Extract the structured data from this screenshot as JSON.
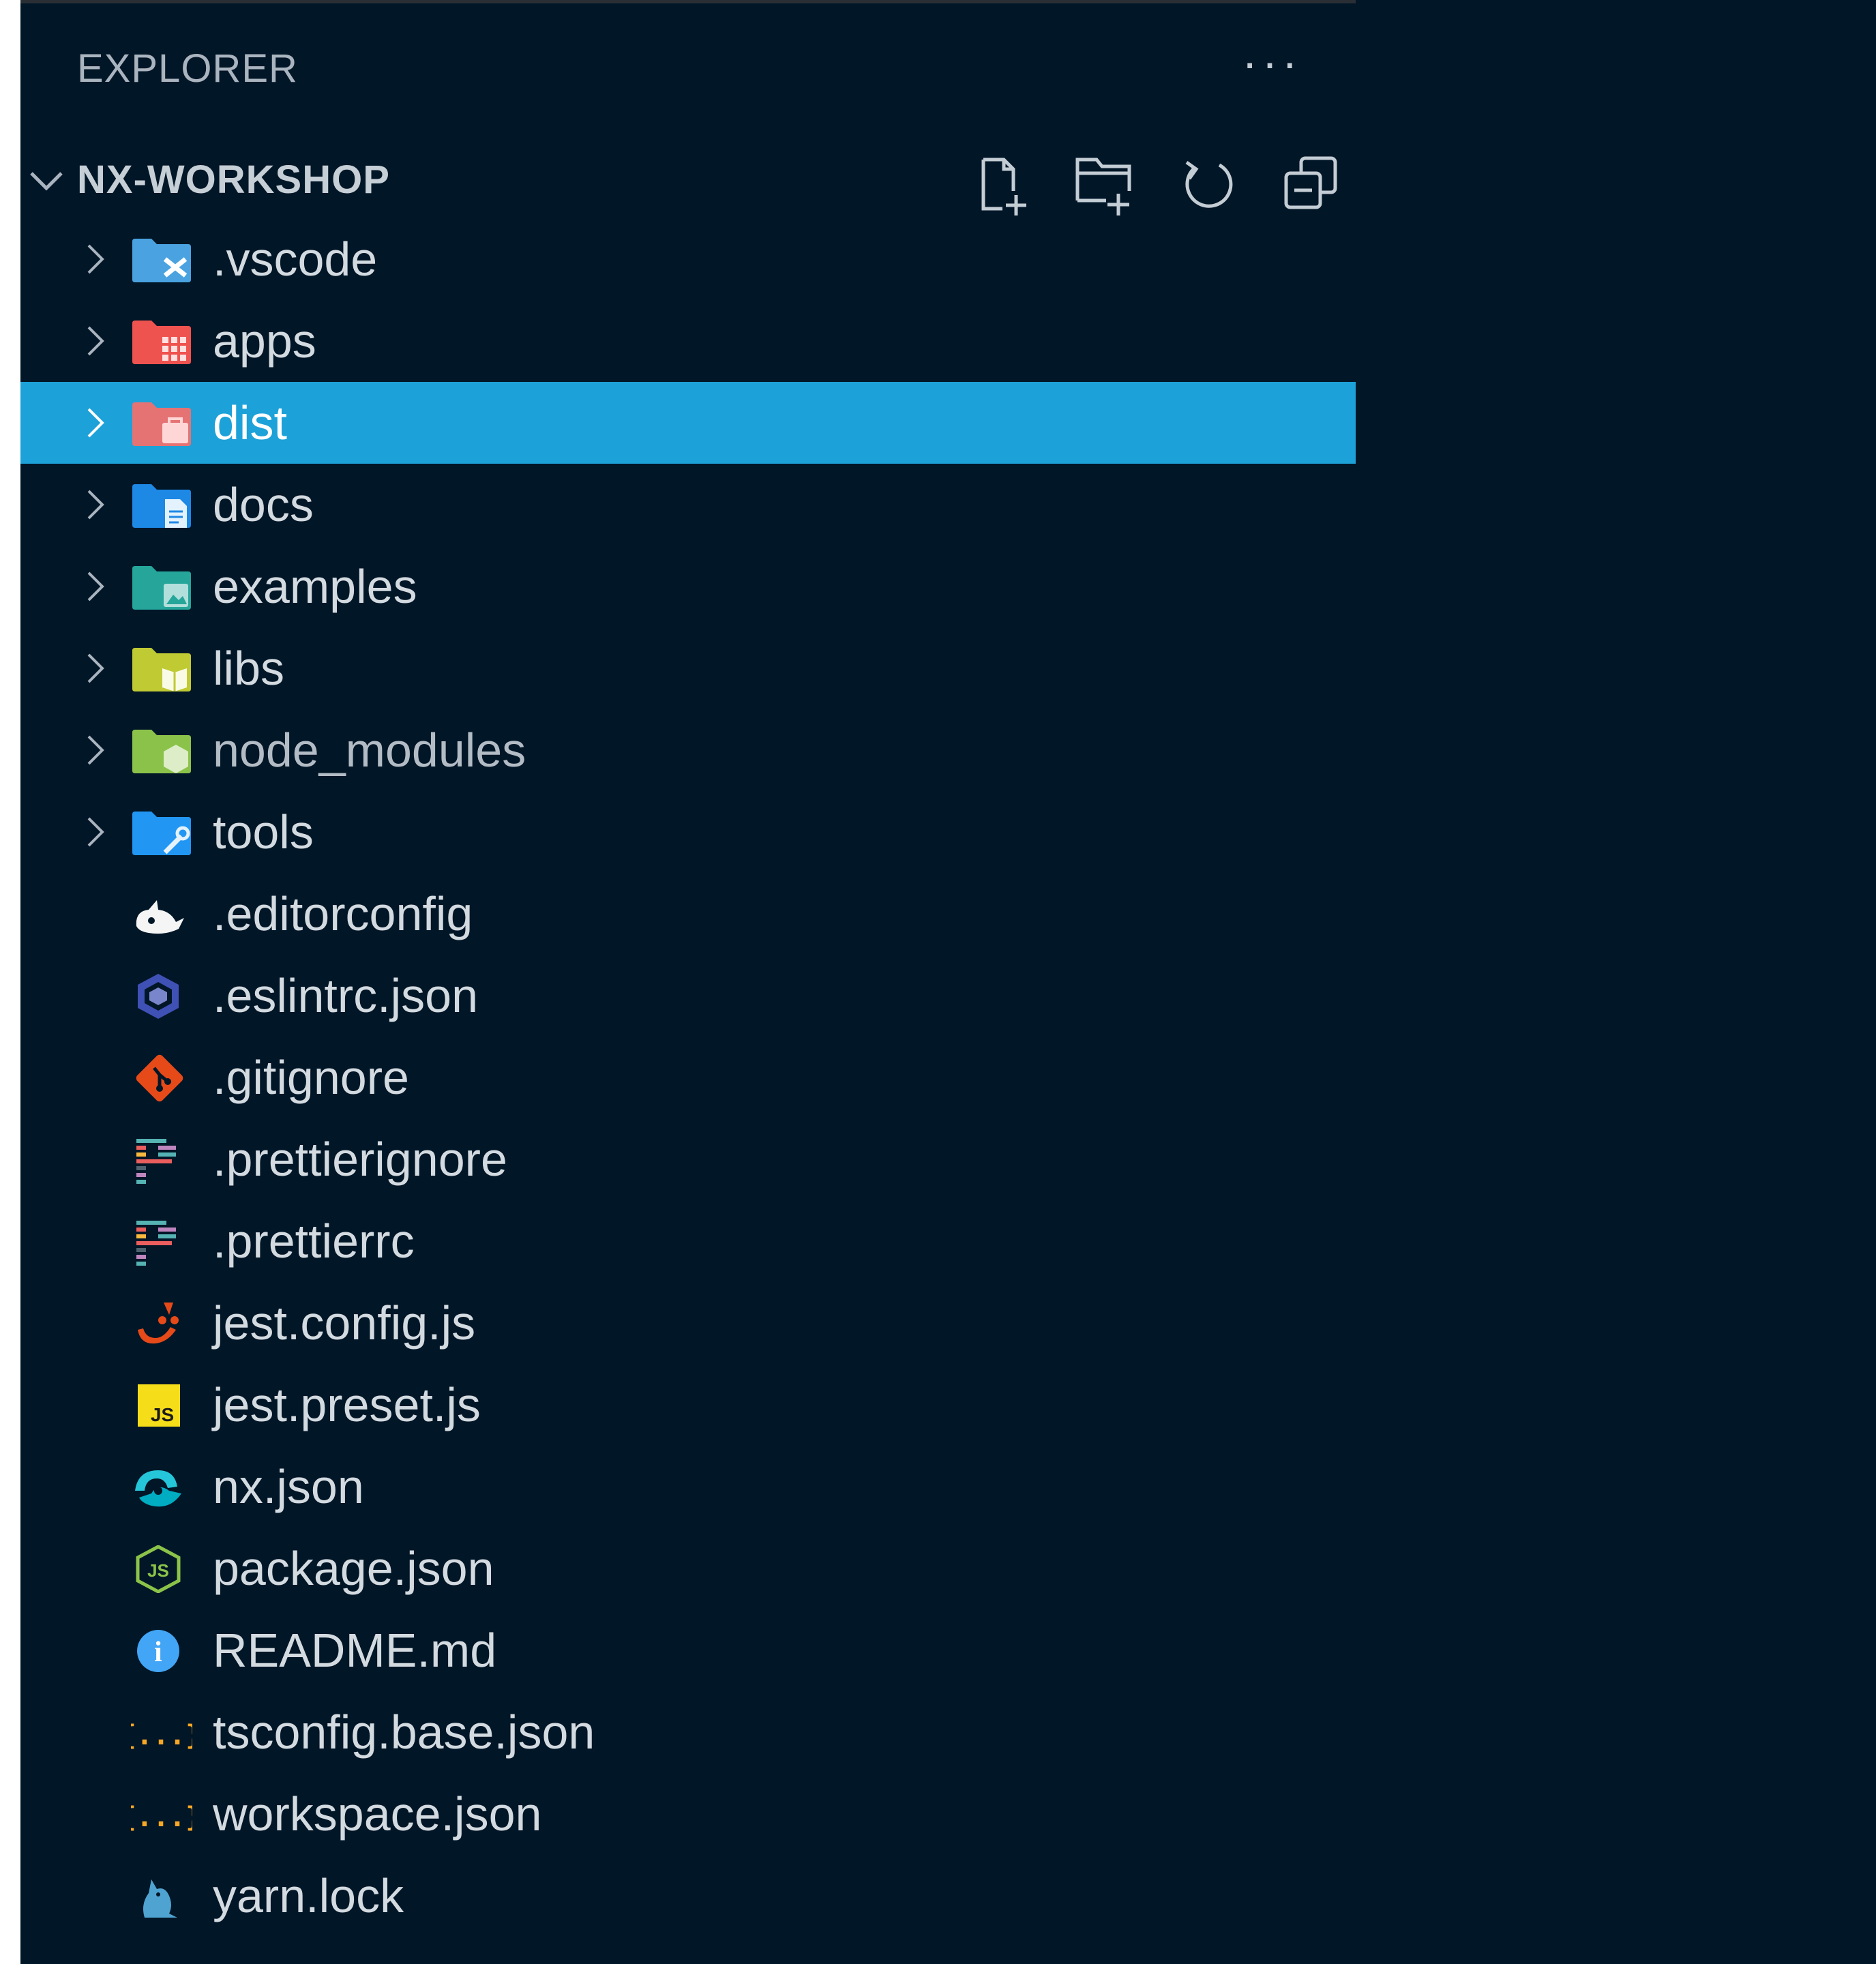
{
  "explorer": {
    "title": "EXPLORER",
    "more_label": "···"
  },
  "workspace": {
    "name": "NX-WORKSHOP",
    "expanded": true,
    "actions": [
      {
        "id": "new-file",
        "icon": "new-file-icon"
      },
      {
        "id": "new-folder",
        "icon": "new-folder-icon"
      },
      {
        "id": "refresh",
        "icon": "refresh-icon"
      },
      {
        "id": "collapse-all",
        "icon": "collapse-all-icon"
      }
    ]
  },
  "tree": {
    "folders": [
      {
        "label": ".vscode",
        "icon": "vscode-folder-icon",
        "color": "#4aa3e0"
      },
      {
        "label": "apps",
        "icon": "apps-folder-icon",
        "color": "#ef5350"
      },
      {
        "label": "dist",
        "icon": "dist-folder-icon",
        "color": "#e57373",
        "selected": true
      },
      {
        "label": "docs",
        "icon": "docs-folder-icon",
        "color": "#1e88e5"
      },
      {
        "label": "examples",
        "icon": "examples-folder-icon",
        "color": "#26a69a"
      },
      {
        "label": "libs",
        "icon": "libs-folder-icon",
        "color": "#c0ca33"
      },
      {
        "label": "node_modules",
        "icon": "node-modules-folder-icon",
        "color": "#8bc34a"
      },
      {
        "label": "tools",
        "icon": "tools-folder-icon",
        "color": "#2196f3"
      }
    ],
    "files": [
      {
        "label": ".editorconfig",
        "icon": "editorconfig-icon"
      },
      {
        "label": ".eslintrc.json",
        "icon": "eslint-icon"
      },
      {
        "label": ".gitignore",
        "icon": "git-icon"
      },
      {
        "label": ".prettierignore",
        "icon": "prettier-icon"
      },
      {
        "label": ".prettierrc",
        "icon": "prettier-icon"
      },
      {
        "label": "jest.config.js",
        "icon": "jest-icon"
      },
      {
        "label": "jest.preset.js",
        "icon": "javascript-icon",
        "glyph": "JS"
      },
      {
        "label": "nx.json",
        "icon": "nx-icon"
      },
      {
        "label": "package.json",
        "icon": "nodejs-icon",
        "glyph": "JS"
      },
      {
        "label": "README.md",
        "icon": "info-icon",
        "glyph": "i"
      },
      {
        "label": "tsconfig.base.json",
        "icon": "json-icon",
        "glyph": "{...}"
      },
      {
        "label": "workspace.json",
        "icon": "json-icon",
        "glyph": "{...}"
      },
      {
        "label": "yarn.lock",
        "icon": "yarn-icon"
      }
    ]
  },
  "colors": {
    "background": "#011627",
    "selection": "#1da1d9"
  }
}
